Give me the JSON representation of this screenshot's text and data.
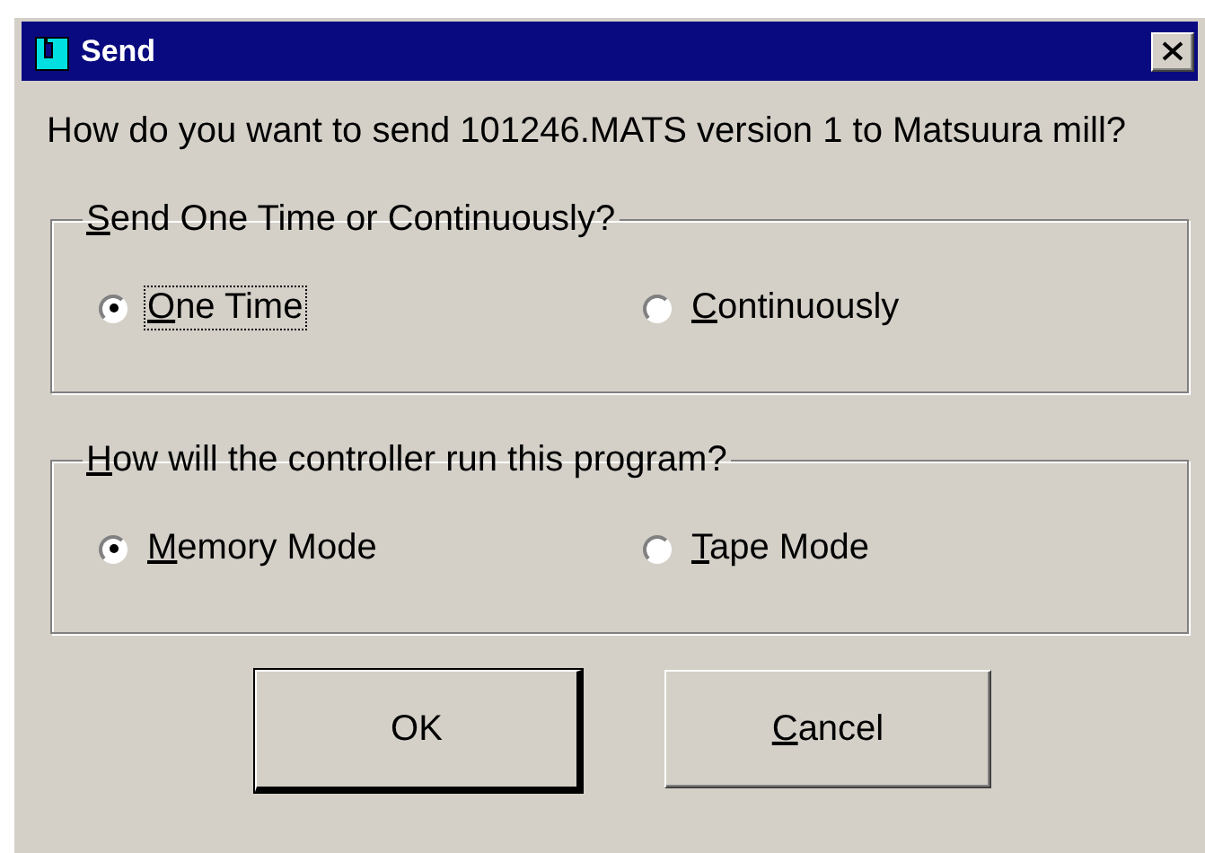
{
  "window": {
    "title": "Send"
  },
  "message": "How do you want to send 101246.MATS version 1 to Matsuura mill?",
  "groups": [
    {
      "legend": "Send One Time or Continuously?",
      "mnemonic": true,
      "options": [
        {
          "label": "One Time",
          "selected": true,
          "focused": true,
          "mnemonic": true
        },
        {
          "label": "Continuously",
          "selected": false,
          "focused": false,
          "mnemonic": true
        }
      ]
    },
    {
      "legend": "How will the controller run this program?",
      "mnemonic": true,
      "options": [
        {
          "label": "Memory Mode",
          "selected": true,
          "focused": false,
          "mnemonic": true
        },
        {
          "label": "Tape Mode",
          "selected": false,
          "focused": false,
          "mnemonic": true
        }
      ]
    }
  ],
  "buttons": [
    {
      "label": "OK",
      "default": true,
      "mnemonic": false
    },
    {
      "label": "Cancel",
      "default": false,
      "mnemonic": true
    }
  ]
}
